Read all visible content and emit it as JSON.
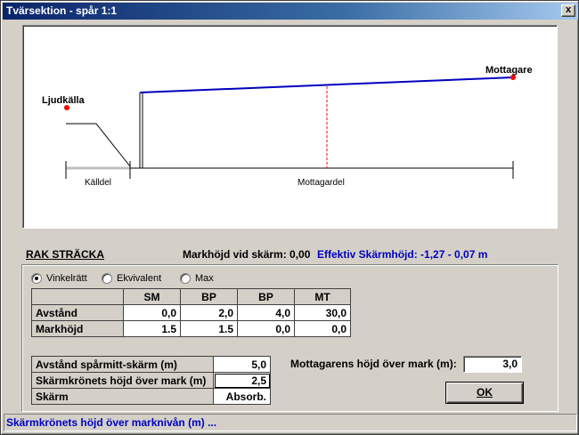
{
  "window": {
    "title": "Tvärsektion - spår 1:1",
    "close_label": "x"
  },
  "diagram": {
    "source_label": "Ljudkälla",
    "receiver_label": "Mottagare",
    "source_section_label": "Källdel",
    "receiver_section_label": "Mottagardel",
    "colors": {
      "ray": "#0000c0",
      "point": "#ff0000",
      "ground_source": "#c0c0c0",
      "ground": "#000000"
    }
  },
  "section": {
    "title": "RAK STRÄCKA",
    "ground_height_label": "Markhöjd vid skärm: 0,00",
    "effective_height_label": "Effektiv Skärmhöjd: -1,27 - 0,07 m"
  },
  "mode": {
    "options": [
      {
        "label": "Vinkelrätt",
        "checked": true
      },
      {
        "label": "Ekvivalent",
        "checked": false
      },
      {
        "label": "Max",
        "checked": false
      }
    ]
  },
  "profile_table": {
    "columns": [
      "SM",
      "BP",
      "BP",
      "MT"
    ],
    "rows": [
      {
        "label": "Avstånd",
        "values": [
          "0,0",
          "2,0",
          "4,0",
          "30,0"
        ]
      },
      {
        "label": "Markhöjd",
        "values": [
          "1.5",
          "1.5",
          "0,0",
          "0,0"
        ]
      }
    ]
  },
  "screen_table": {
    "rows": [
      {
        "label": "Avstånd spårmitt-skärm (m)",
        "value": "5,0"
      },
      {
        "label": "Skärmkrönets höjd över mark (m)",
        "value": "2,5"
      },
      {
        "label": "Skärm",
        "value": "Absorb."
      }
    ]
  },
  "receiver": {
    "label": "Mottagarens höjd över mark (m):",
    "value": "3,0"
  },
  "buttons": {
    "ok": "OK"
  },
  "status": {
    "text": "Skärmkrönets höjd över marknivån (m) ..."
  }
}
